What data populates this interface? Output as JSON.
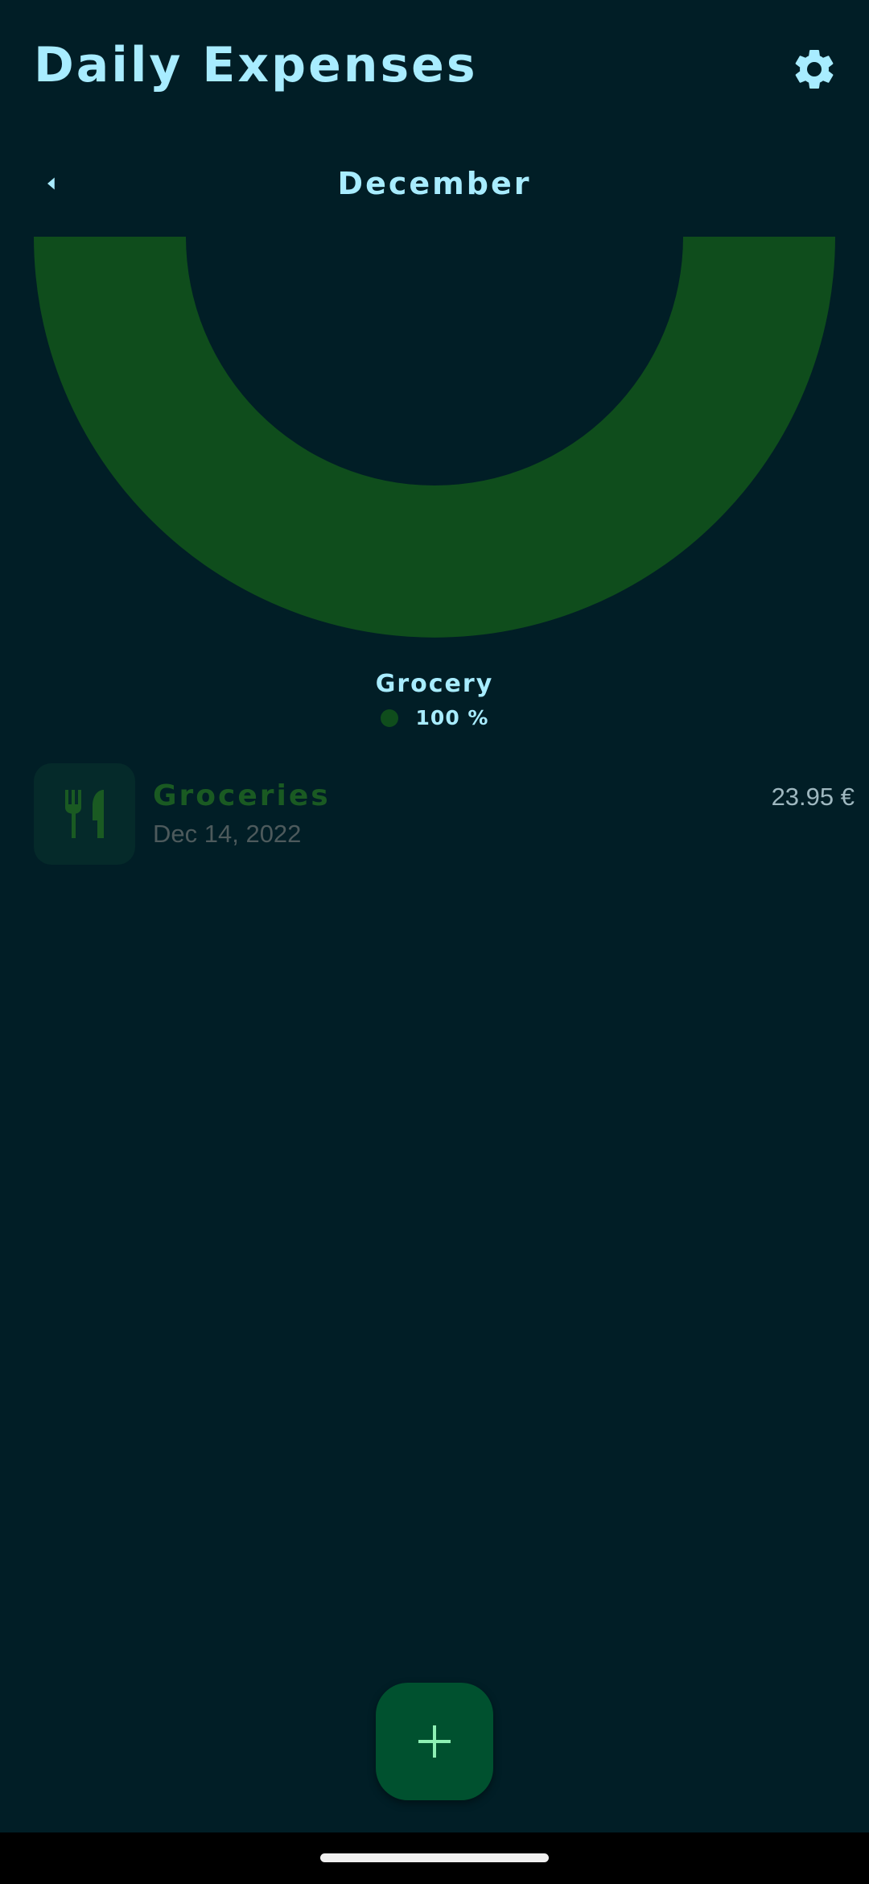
{
  "header": {
    "title": "Daily Expenses",
    "settings_icon": "gear-icon"
  },
  "month_nav": {
    "prev_icon": "chevron-left-icon",
    "label": "December"
  },
  "chart_data": {
    "type": "pie",
    "shape": "half-donut",
    "categories": [
      "Grocery"
    ],
    "values": [
      100
    ],
    "colors": [
      "#0f4d1c"
    ],
    "legend_position": "bottom-center"
  },
  "legend": [
    {
      "name": "Grocery",
      "percent": "100 %"
    }
  ],
  "expenses": [
    {
      "icon": "fork-knife-icon",
      "title": "Groceries",
      "date": "Dec 14, 2022",
      "amount": "23.95 €"
    }
  ],
  "fab": {
    "icon": "plus-icon"
  },
  "colors": {
    "background": "#011e26",
    "accent_text": "#a8ecff",
    "chart_green": "#0f4d1c",
    "fab": "#00512f",
    "fab_icon": "#8ef0b4"
  }
}
